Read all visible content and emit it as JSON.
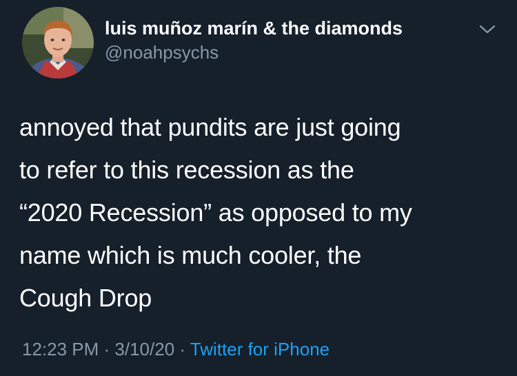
{
  "colors": {
    "background": "#15202b",
    "text_primary": "#ffffff",
    "text_secondary": "#8899a6",
    "link": "#1da1f2"
  },
  "author": {
    "display_name": "luis muñoz marín & the diamonds",
    "handle": "@noahpsychs",
    "avatar_icon": "profile-photo"
  },
  "menu": {
    "icon": "chevron-down-icon"
  },
  "tweet": {
    "lines": [
      "annoyed that pundits are just going",
      "to refer to this recession as the",
      "“2020 Recession” as opposed to my",
      "name which is much cooler, the",
      "Cough Drop"
    ]
  },
  "meta": {
    "time": "12:23 PM",
    "separator_1": " · ",
    "date": "3/10/20",
    "separator_2": " · ",
    "source": "Twitter for iPhone"
  }
}
